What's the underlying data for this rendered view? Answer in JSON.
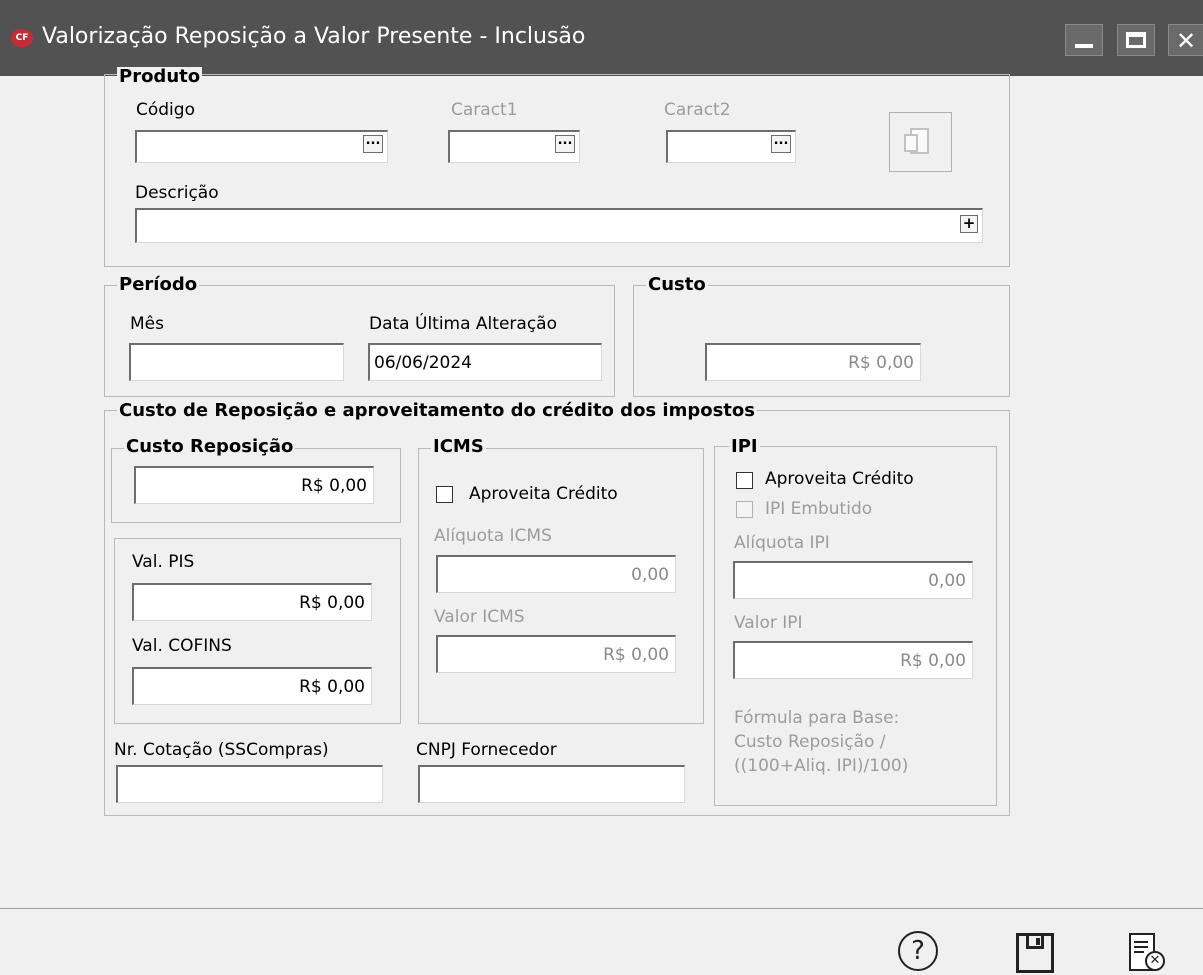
{
  "window": {
    "title": "Valorização Reposição a Valor Presente - Inclusão",
    "icon_text": "CF"
  },
  "produto": {
    "legend": "Produto",
    "codigo_label": "Código",
    "codigo_value": "",
    "caract1_label": "Caract1",
    "caract1_value": "",
    "caract2_label": "Caract2",
    "caract2_value": "",
    "descricao_label": "Descrição",
    "descricao_value": "",
    "lookup_button_label": "...",
    "expand_button_label": "+"
  },
  "periodo": {
    "legend": "Período",
    "mes_label": "Mês",
    "mes_value": "",
    "data_label": "Data Última Alteração",
    "data_value": "06/06/2024"
  },
  "custo": {
    "legend": "Custo",
    "value": "R$ 0,00"
  },
  "reposicao": {
    "legend": "Custo de Reposição e aproveitamento do crédito dos impostos",
    "custo_reposicao": {
      "legend": "Custo Reposição",
      "value": "R$ 0,00"
    },
    "pis_label": "Val. PIS",
    "pis_value": "R$ 0,00",
    "cofins_label": "Val. COFINS",
    "cofins_value": "R$ 0,00",
    "icms": {
      "legend": "ICMS",
      "aproveita_label": "Aproveita Crédito",
      "aproveita_checked": false,
      "aliquota_label": "Alíquota ICMS",
      "aliquota_value": "0,00",
      "valor_label": "Valor ICMS",
      "valor_value": "R$ 0,00"
    },
    "ipi": {
      "legend": "IPI",
      "aproveita_label": "Aproveita Crédito",
      "aproveita_checked": false,
      "embutido_label": "IPI Embutido",
      "embutido_checked": false,
      "aliquota_label": "Alíquota IPI",
      "aliquota_value": "0,00",
      "valor_label": "Valor IPI",
      "valor_value": "R$ 0,00",
      "formula_line1": "Fórmula para Base:",
      "formula_line2": "Custo Reposição /",
      "formula_line3": "((100+Aliq. IPI)/100)"
    },
    "cotacao_label": "Nr. Cotação (SSCompras)",
    "cotacao_value": "",
    "cnpj_label": "CNPJ Fornecedor",
    "cnpj_value": ""
  },
  "footer": {
    "help_icon": "help-icon",
    "save_icon": "save-icon",
    "cancel_icon": "cancel-document-icon"
  }
}
